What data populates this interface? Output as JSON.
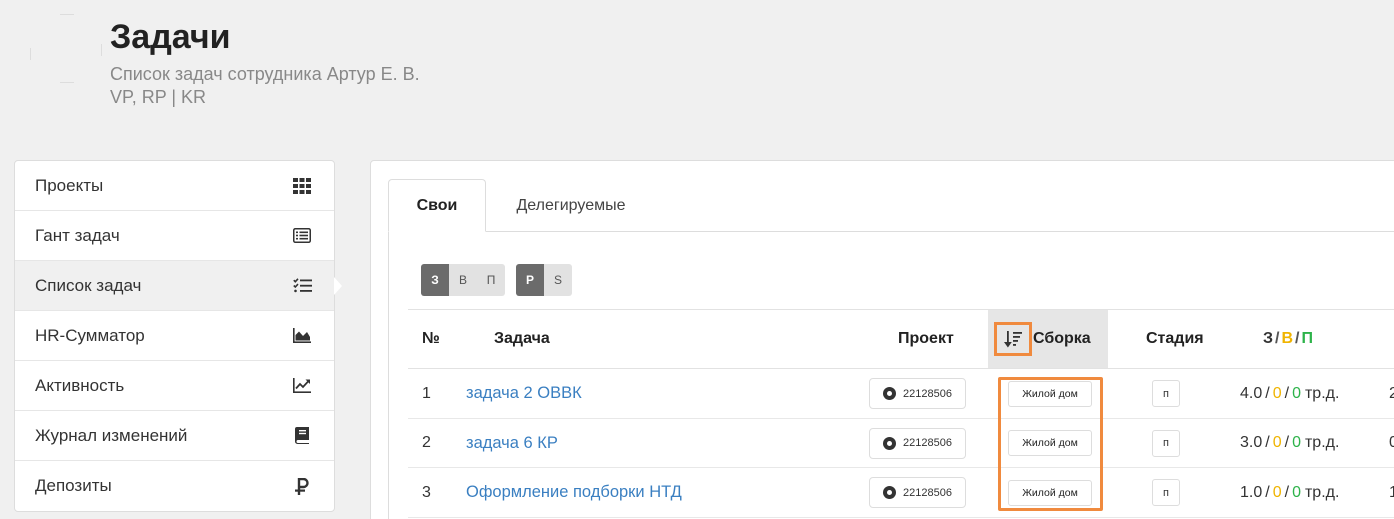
{
  "header": {
    "title": "Задачи",
    "subtitle_line1": "Список задач сотрудника Артур Е. В.",
    "subtitle_line2": "VP, RP | KR"
  },
  "sidebar": {
    "items": [
      {
        "label": "Проекты",
        "icon": "grid-icon"
      },
      {
        "label": "Гант задач",
        "icon": "list-alt-icon"
      },
      {
        "label": "Список задач",
        "icon": "tasks-checklist-icon",
        "active": true
      },
      {
        "label": "HR-Сумматор",
        "icon": "area-chart-icon"
      },
      {
        "label": "Активность",
        "icon": "line-chart-icon"
      },
      {
        "label": "Журнал изменений",
        "icon": "book-icon"
      },
      {
        "label": "Депозиты",
        "icon": "ruble-icon"
      }
    ]
  },
  "tabs": {
    "own": "Свои",
    "delegated": "Делегируемые"
  },
  "filters": {
    "group1": [
      "З",
      "В",
      "П"
    ],
    "group2": [
      "Р",
      "S"
    ]
  },
  "table": {
    "headers": {
      "num": "№",
      "task": "Задача",
      "project": "Проект",
      "assembly": "Сборка",
      "stage": "Стадия",
      "z": "З",
      "v": "В",
      "p": "П",
      "sep": "/"
    },
    "rows": [
      {
        "num": "1",
        "task": "задача 2 ОВВК",
        "project": "22128506",
        "assembly": "Жилой дом",
        "stage": "п",
        "z": "4.0",
        "v": "0",
        "p": "0",
        "unit": "тр.д.",
        "extra": "2"
      },
      {
        "num": "2",
        "task": "задача 6 КР",
        "project": "22128506",
        "assembly": "Жилой дом",
        "stage": "п",
        "z": "3.0",
        "v": "0",
        "p": "0",
        "unit": "тр.д.",
        "extra": "0"
      },
      {
        "num": "3",
        "task": "Оформление подборки НТД",
        "project": "22128506",
        "assembly": "Жилой дом",
        "stage": "п",
        "z": "1.0",
        "v": "0",
        "p": "0",
        "unit": "тр.д.",
        "extra": "1"
      }
    ]
  },
  "colors": {
    "link": "#3a7fc1",
    "v": "#f0b400",
    "p": "#2db34a",
    "highlight": "#f08a3e"
  }
}
